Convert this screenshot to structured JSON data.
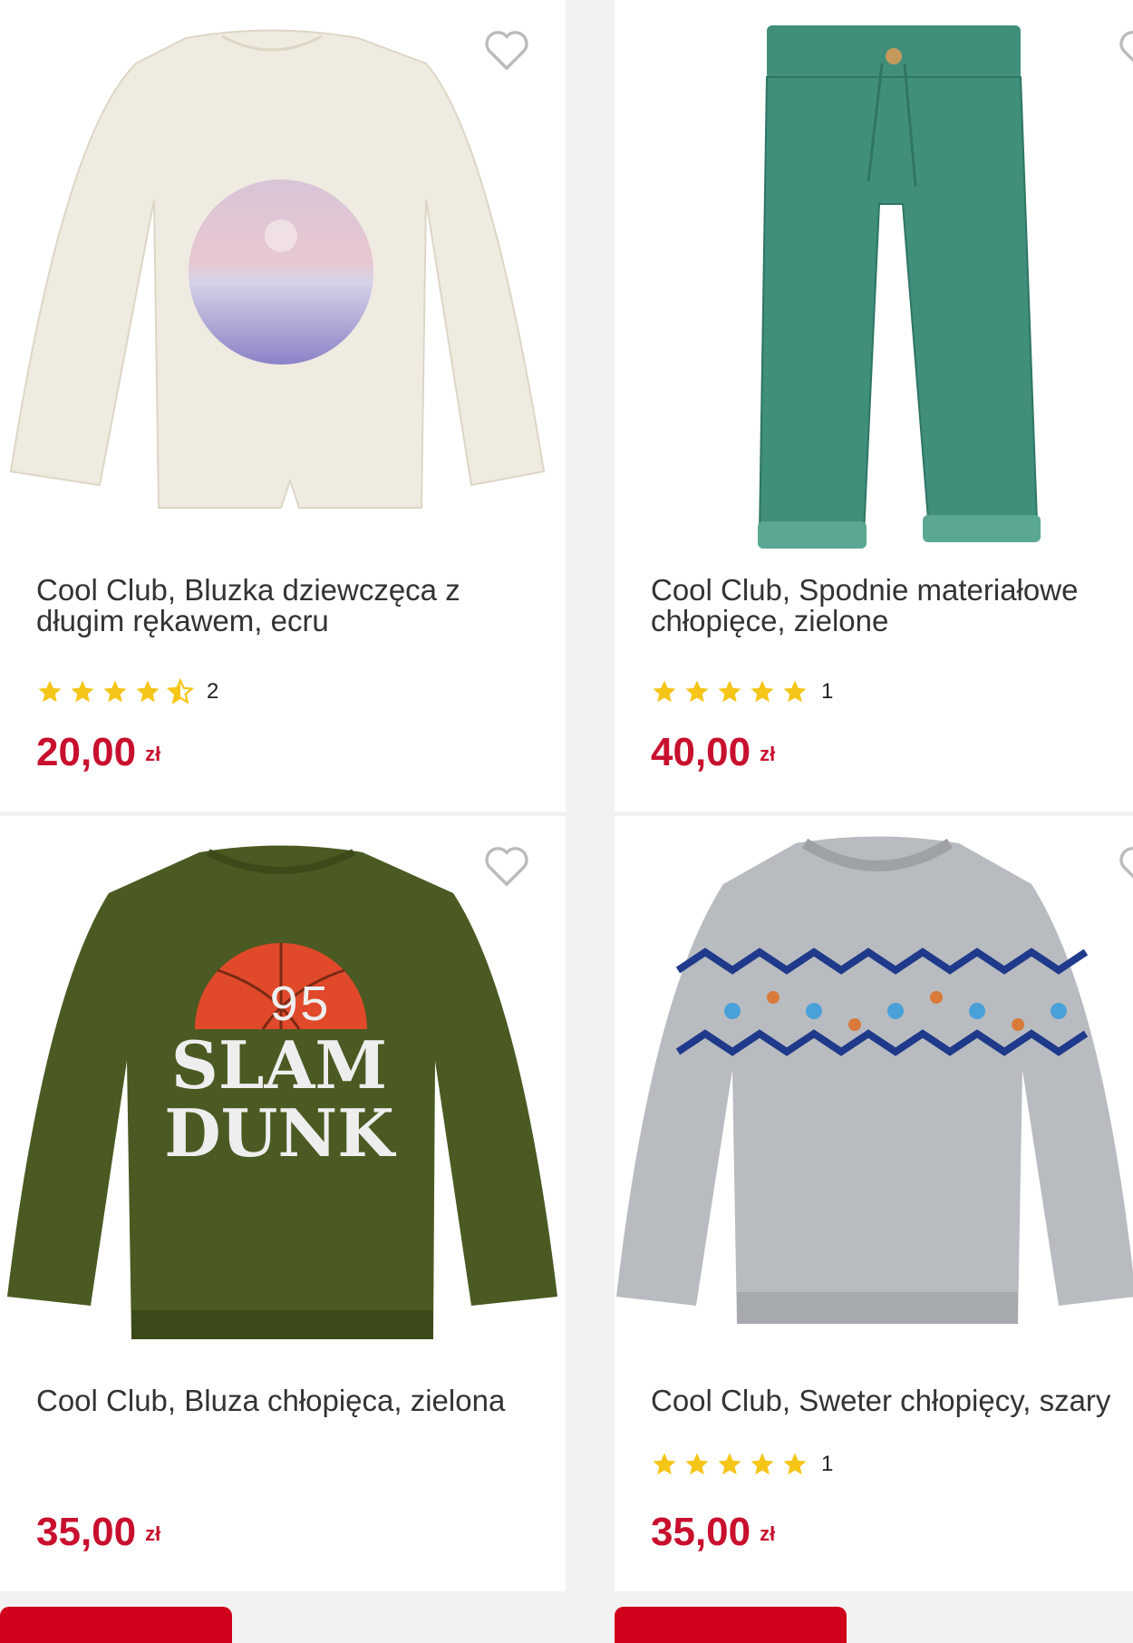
{
  "colors": {
    "price": "#c8102e",
    "star": "#f5c518",
    "accent": "#d0021b"
  },
  "products": [
    {
      "title": "Cool Club, Bluzka dziewczęca z długim rękawem, ecru",
      "rating": 4.5,
      "reviews": "2",
      "price": "20,00",
      "currency": "zł",
      "wish_icon": "heart-outline-icon"
    },
    {
      "title": "Cool Club, Spodnie materiałowe chłopięce, zielone",
      "rating": 5,
      "reviews": "1",
      "price": "40,00",
      "currency": "zł",
      "wish_icon": "heart-outline-icon"
    },
    {
      "title": "Cool Club, Bluza chłopięca, zielona",
      "rating": null,
      "reviews": "",
      "price": "35,00",
      "currency": "zł",
      "wish_icon": "heart-outline-icon"
    },
    {
      "title": "Cool Club, Sweter chłopięcy, szary",
      "rating": 5,
      "reviews": "1",
      "price": "35,00",
      "currency": "zł",
      "wish_icon": "heart-outline-icon"
    }
  ],
  "print_text": {
    "number": "95",
    "line1": "SLAM",
    "line2": "DUNK"
  }
}
